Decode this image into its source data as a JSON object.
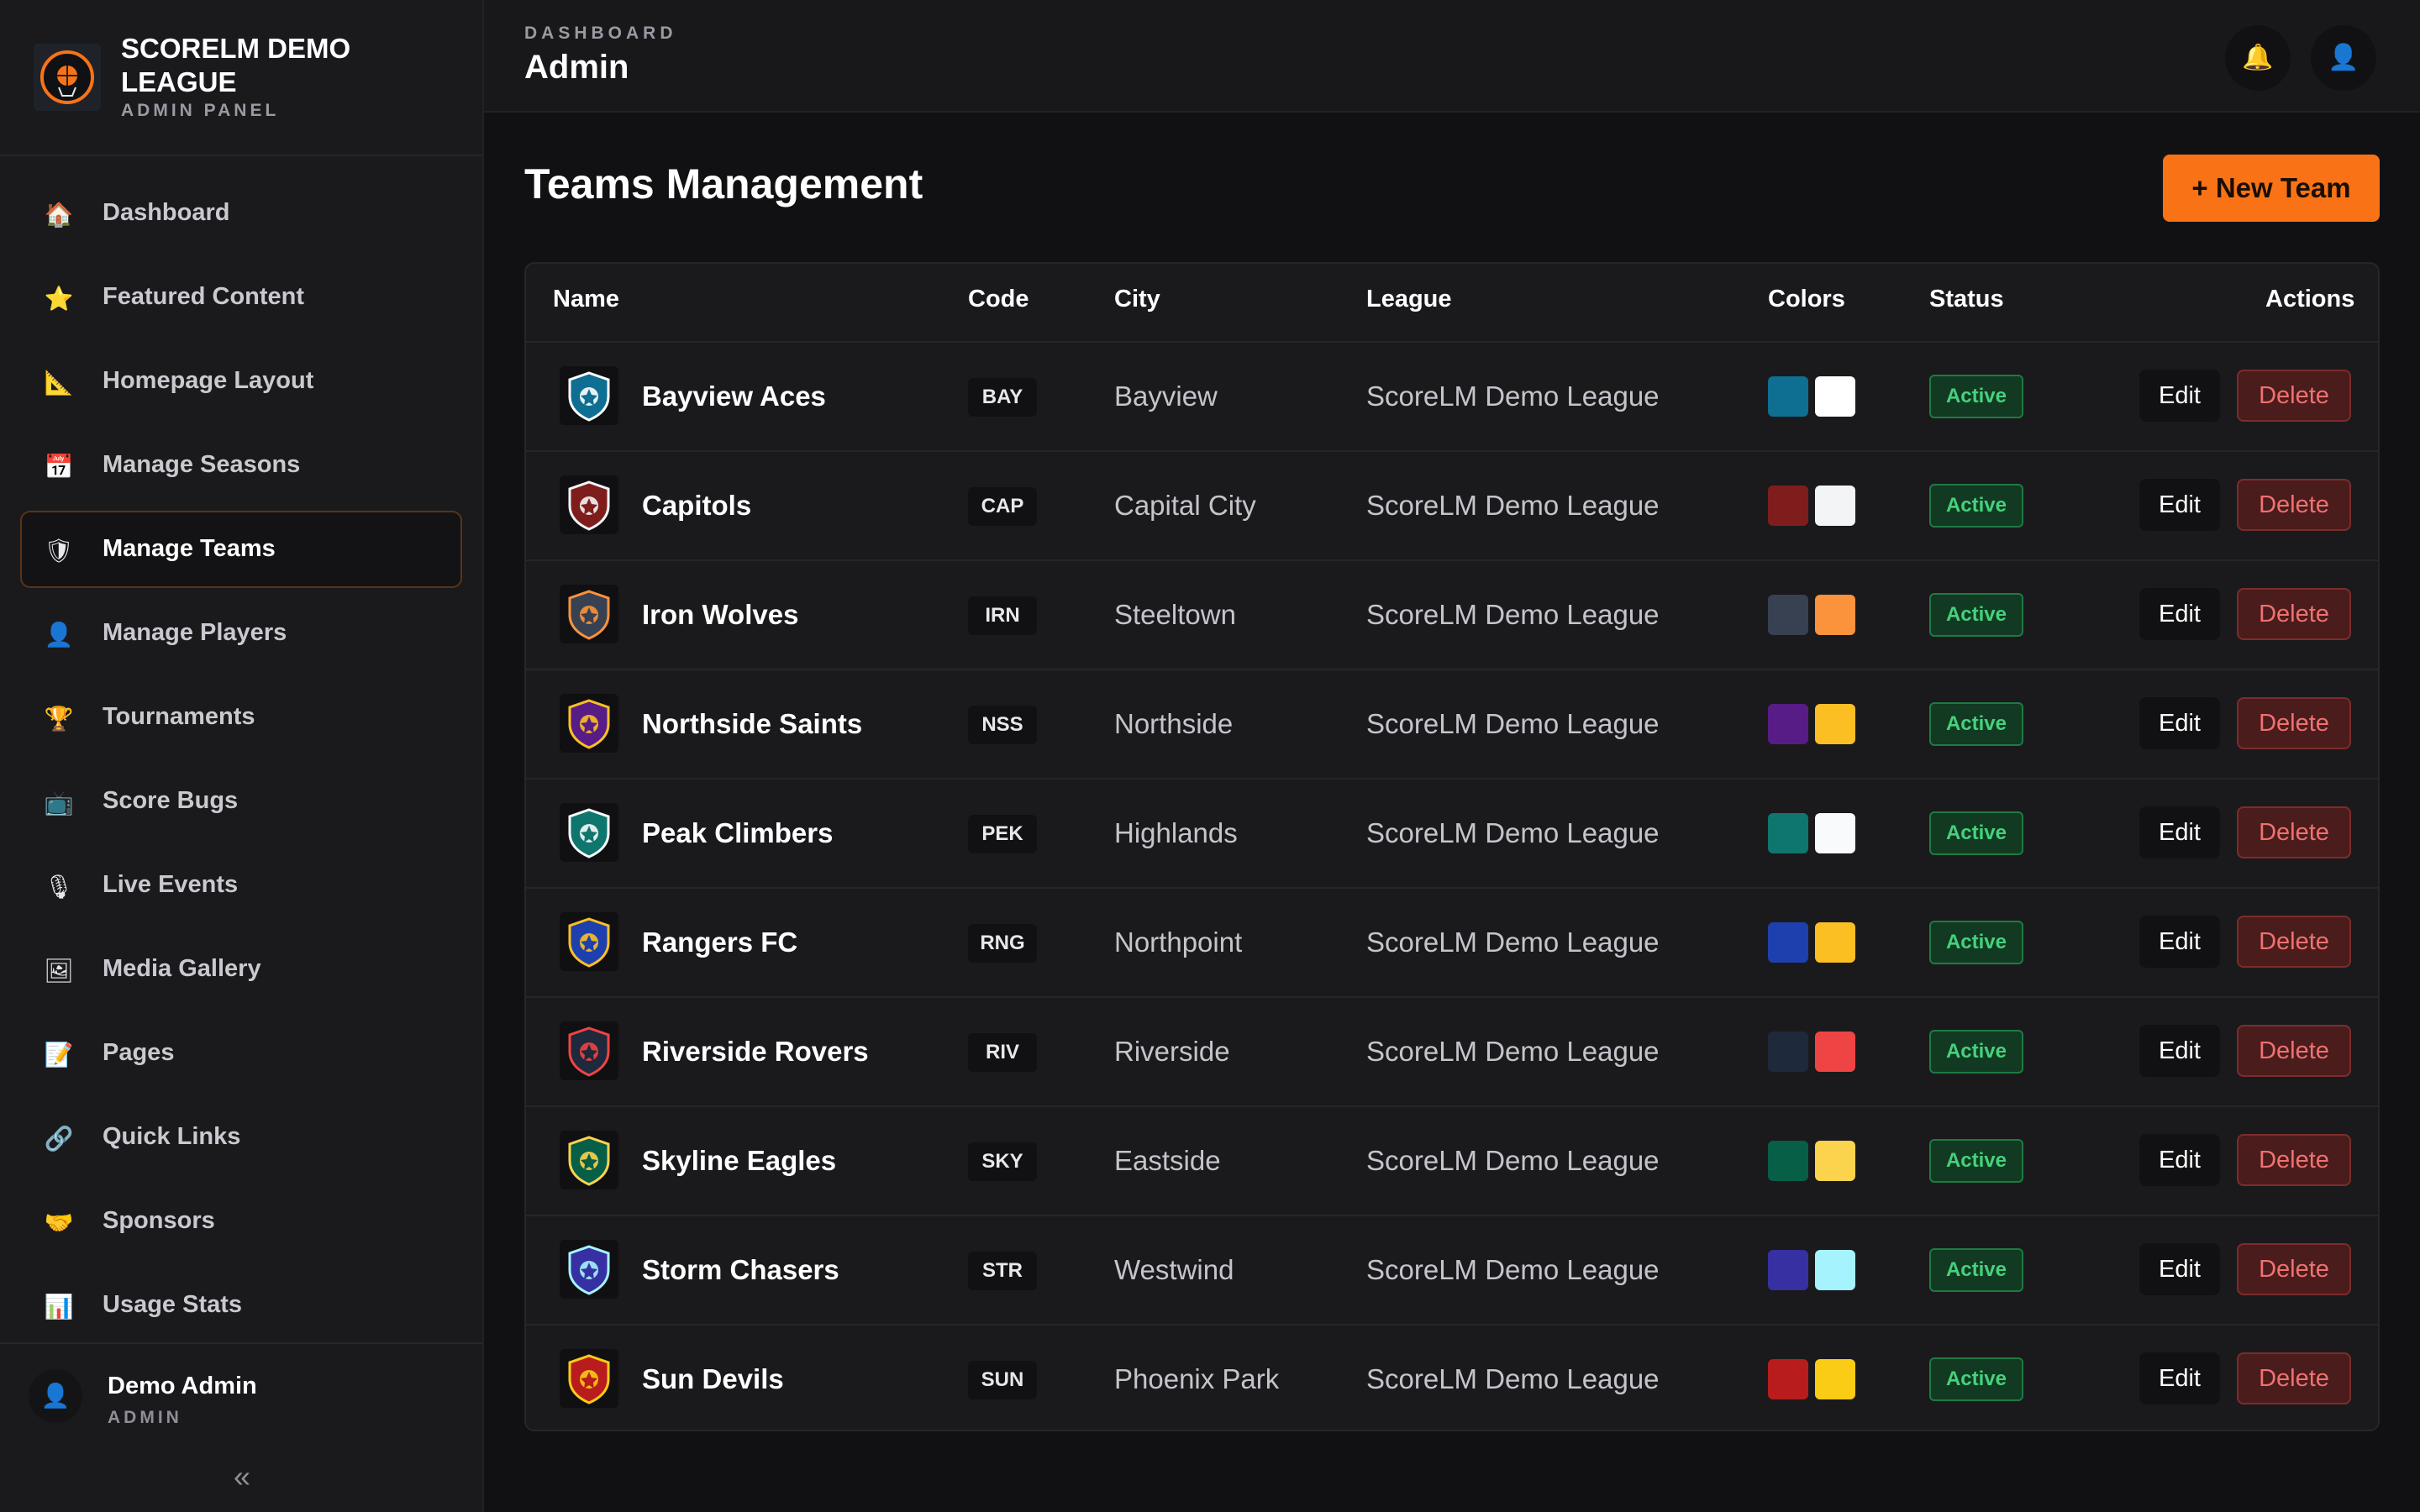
{
  "brand": {
    "title": "SCORELM DEMO LEAGUE",
    "subtitle": "ADMIN PANEL"
  },
  "sidebar": {
    "items": [
      {
        "label": "Dashboard",
        "icon": "house-icon",
        "glyph": "🏠"
      },
      {
        "label": "Featured Content",
        "icon": "star-icon",
        "glyph": "⭐"
      },
      {
        "label": "Homepage Layout",
        "icon": "ruler-icon",
        "glyph": "📐"
      },
      {
        "label": "Manage Seasons",
        "icon": "calendar-icon",
        "glyph": "📅"
      },
      {
        "label": "Manage Teams",
        "icon": "shield-icon",
        "glyph": "🛡",
        "active": true
      },
      {
        "label": "Manage Players",
        "icon": "person-icon",
        "glyph": "👤"
      },
      {
        "label": "Tournaments",
        "icon": "trophy-icon",
        "glyph": "🏆"
      },
      {
        "label": "Score Bugs",
        "icon": "tv-icon",
        "glyph": "📺"
      },
      {
        "label": "Live Events",
        "icon": "microphone-icon",
        "glyph": "🎙"
      },
      {
        "label": "Media Gallery",
        "icon": "picture-icon",
        "glyph": "🖼"
      },
      {
        "label": "Pages",
        "icon": "memo-icon",
        "glyph": "📝"
      },
      {
        "label": "Quick Links",
        "icon": "link-icon",
        "glyph": "🔗"
      },
      {
        "label": "Sponsors",
        "icon": "handshake-icon",
        "glyph": "🤝"
      },
      {
        "label": "Usage Stats",
        "icon": "bar-chart-icon",
        "glyph": "📊"
      }
    ]
  },
  "user": {
    "name": "Demo Admin",
    "role": "ADMIN",
    "avatar_glyph": "👤",
    "collapse_glyph": "«"
  },
  "header": {
    "breadcrumb": "DASHBOARD",
    "title": "Admin",
    "bell_glyph": "🔔",
    "profile_glyph": "👤"
  },
  "main": {
    "title": "Teams Management",
    "new_button": "+ New Team"
  },
  "table": {
    "columns": {
      "name": "Name",
      "code": "Code",
      "city": "City",
      "league": "League",
      "colors": "Colors",
      "status": "Status",
      "actions": "Actions"
    },
    "edit_label": "Edit",
    "delete_label": "Delete",
    "rows": [
      {
        "name": "Bayview Aces",
        "code": "BAY",
        "city": "Bayview",
        "league": "ScoreLM Demo League",
        "primary": "#0e6f92",
        "secondary": "#ffffff",
        "status": "Active"
      },
      {
        "name": "Capitols",
        "code": "CAP",
        "city": "Capital City",
        "league": "ScoreLM Demo League",
        "primary": "#7f1d1d",
        "secondary": "#f3f4f6",
        "status": "Active"
      },
      {
        "name": "Iron Wolves",
        "code": "IRN",
        "city": "Steeltown",
        "league": "ScoreLM Demo League",
        "primary": "#374151",
        "secondary": "#fb923c",
        "status": "Active"
      },
      {
        "name": "Northside Saints",
        "code": "NSS",
        "city": "Northside",
        "league": "ScoreLM Demo League",
        "primary": "#581c87",
        "secondary": "#fbbf24",
        "status": "Active"
      },
      {
        "name": "Peak Climbers",
        "code": "PEK",
        "city": "Highlands",
        "league": "ScoreLM Demo League",
        "primary": "#0f766e",
        "secondary": "#f8fafc",
        "status": "Active"
      },
      {
        "name": "Rangers FC",
        "code": "RNG",
        "city": "Northpoint",
        "league": "ScoreLM Demo League",
        "primary": "#1e40af",
        "secondary": "#fbbf24",
        "status": "Active"
      },
      {
        "name": "Riverside Rovers",
        "code": "RIV",
        "city": "Riverside",
        "league": "ScoreLM Demo League",
        "primary": "#1e293b",
        "secondary": "#ef4444",
        "status": "Active"
      },
      {
        "name": "Skyline Eagles",
        "code": "SKY",
        "city": "Eastside",
        "league": "ScoreLM Demo League",
        "primary": "#065f46",
        "secondary": "#fcd34d",
        "status": "Active"
      },
      {
        "name": "Storm Chasers",
        "code": "STR",
        "city": "Westwind",
        "league": "ScoreLM Demo League",
        "primary": "#3730a3",
        "secondary": "#a5f3fc",
        "status": "Active"
      },
      {
        "name": "Sun Devils",
        "code": "SUN",
        "city": "Phoenix Park",
        "league": "ScoreLM Demo League",
        "primary": "#b91c1c",
        "secondary": "#facc15",
        "status": "Active"
      }
    ]
  },
  "colors": {
    "accent": "#f97316",
    "background": "#111113",
    "panel": "#1a1a1d",
    "status_active": "#46d17d",
    "danger": "#f07171"
  }
}
